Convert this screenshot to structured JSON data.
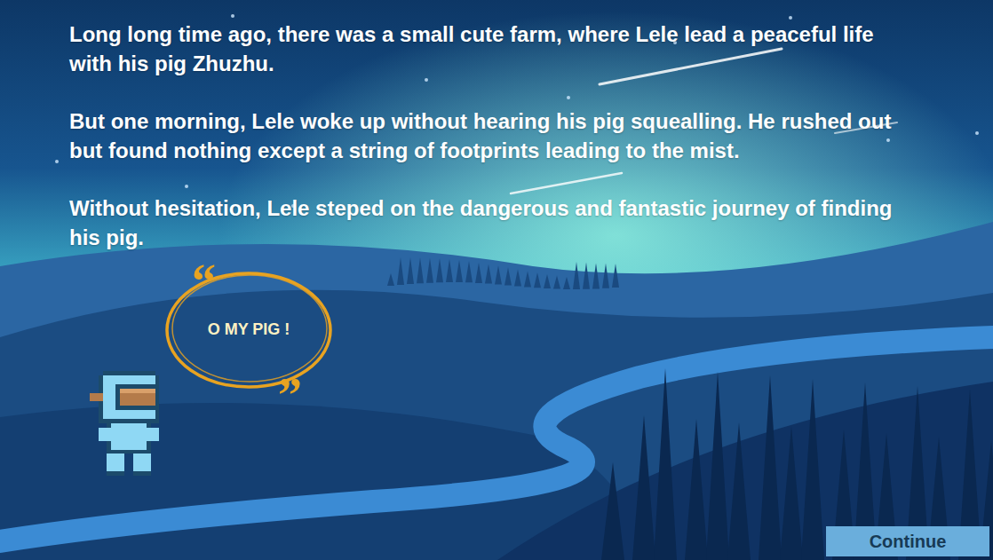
{
  "story": {
    "paragraphs": [
      "Long long time ago, there was a small cute farm, where Lele lead a peaceful life with his pig Zhuzhu.",
      "But one morning, Lele woke up without hearing his pig squealling. He rushed out but found nothing except a string of footprints leading to the mist.",
      "Without hesitation, Lele steped on the dangerous and fantastic journey of finding his pig."
    ]
  },
  "speech_bubble": {
    "text": "O MY PIG !",
    "quote_open": "“",
    "quote_close": "”"
  },
  "buttons": [
    "Continue"
  ]
}
